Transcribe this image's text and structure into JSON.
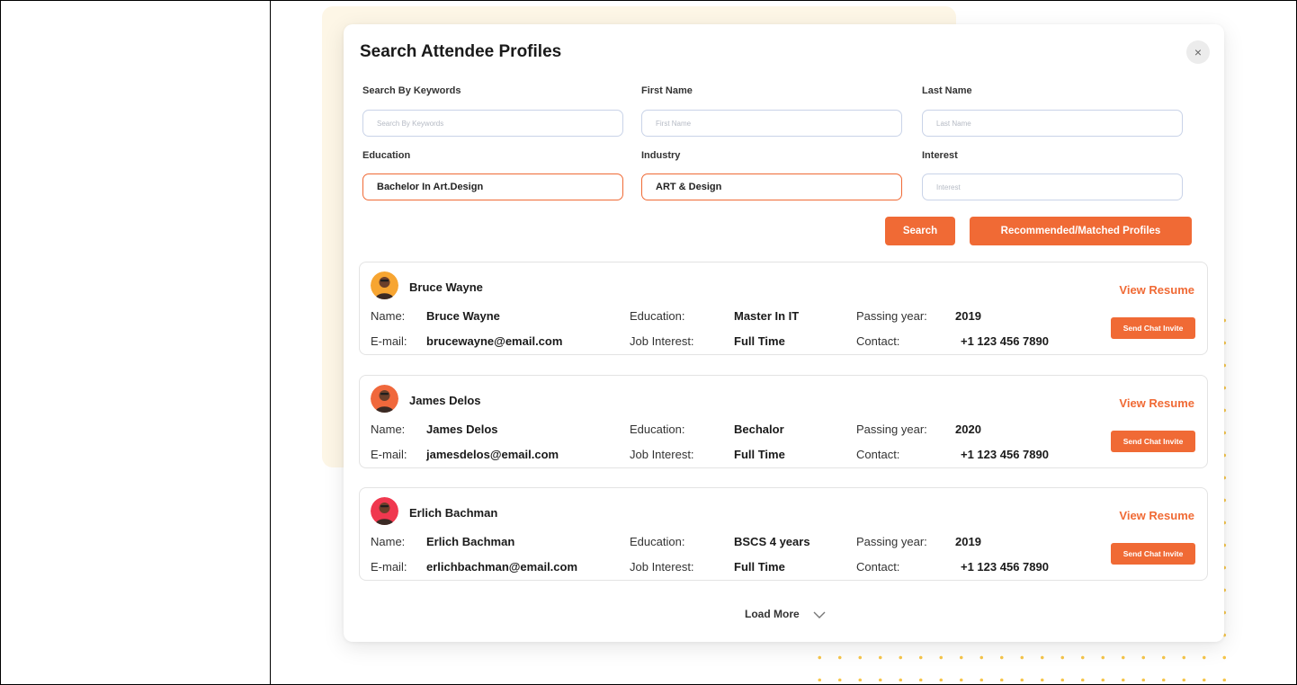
{
  "modal": {
    "title": "Search Attendee Profiles",
    "close_icon": "×"
  },
  "filters": {
    "keywords": {
      "label": "Search By Keywords",
      "placeholder": "Search By Keywords",
      "value": ""
    },
    "first_name": {
      "label": "First Name",
      "placeholder": "First Name",
      "value": ""
    },
    "last_name": {
      "label": "Last Name",
      "placeholder": "Last Name",
      "value": ""
    },
    "education": {
      "label": "Education",
      "placeholder": "",
      "value": "Bachelor In Art.Design"
    },
    "industry": {
      "label": "Industry",
      "placeholder": "",
      "value": "ART & Design"
    },
    "interest": {
      "label": "Interest",
      "placeholder": "Interest",
      "value": ""
    }
  },
  "buttons": {
    "search": "Search",
    "recommended": "Recommended/Matched Profiles"
  },
  "labels": {
    "name": "Name:",
    "email": "E-mail:",
    "education": "Education:",
    "job_interest": "Job Interest:",
    "passing_year": "Passing year:",
    "contact": "Contact:",
    "view_resume": "View Resume",
    "send_chat_invite": "Send Chat Invite"
  },
  "profiles": [
    {
      "name": "Bruce Wayne",
      "email": "brucewayne@email.com",
      "education": "Master In IT",
      "job_interest": "Full Time",
      "passing_year": "2019",
      "contact": "+1 123 456 7890",
      "avatar_color": "#f7a531"
    },
    {
      "name": "James Delos",
      "email": "jamesdelos@email.com",
      "education": "Bechalor",
      "job_interest": "Full Time",
      "passing_year": "2020",
      "contact": "+1 123 456 7890",
      "avatar_color": "#f0683c"
    },
    {
      "name": "Erlich Bachman",
      "email": "erlichbachman@email.com",
      "education": "BSCS 4 years",
      "job_interest": "Full Time",
      "passing_year": "2019",
      "contact": "+1 123 456 7890",
      "avatar_color": "#f0384f"
    }
  ],
  "load_more": "Load More",
  "icons": {
    "close": "close-icon",
    "load_more": "chevron-down-icon",
    "avatar": "avatar-person-icon"
  },
  "colors": {
    "accent": "#f06a35",
    "beige_panel": "#fdf6e6",
    "dots": "#f6c64c"
  }
}
